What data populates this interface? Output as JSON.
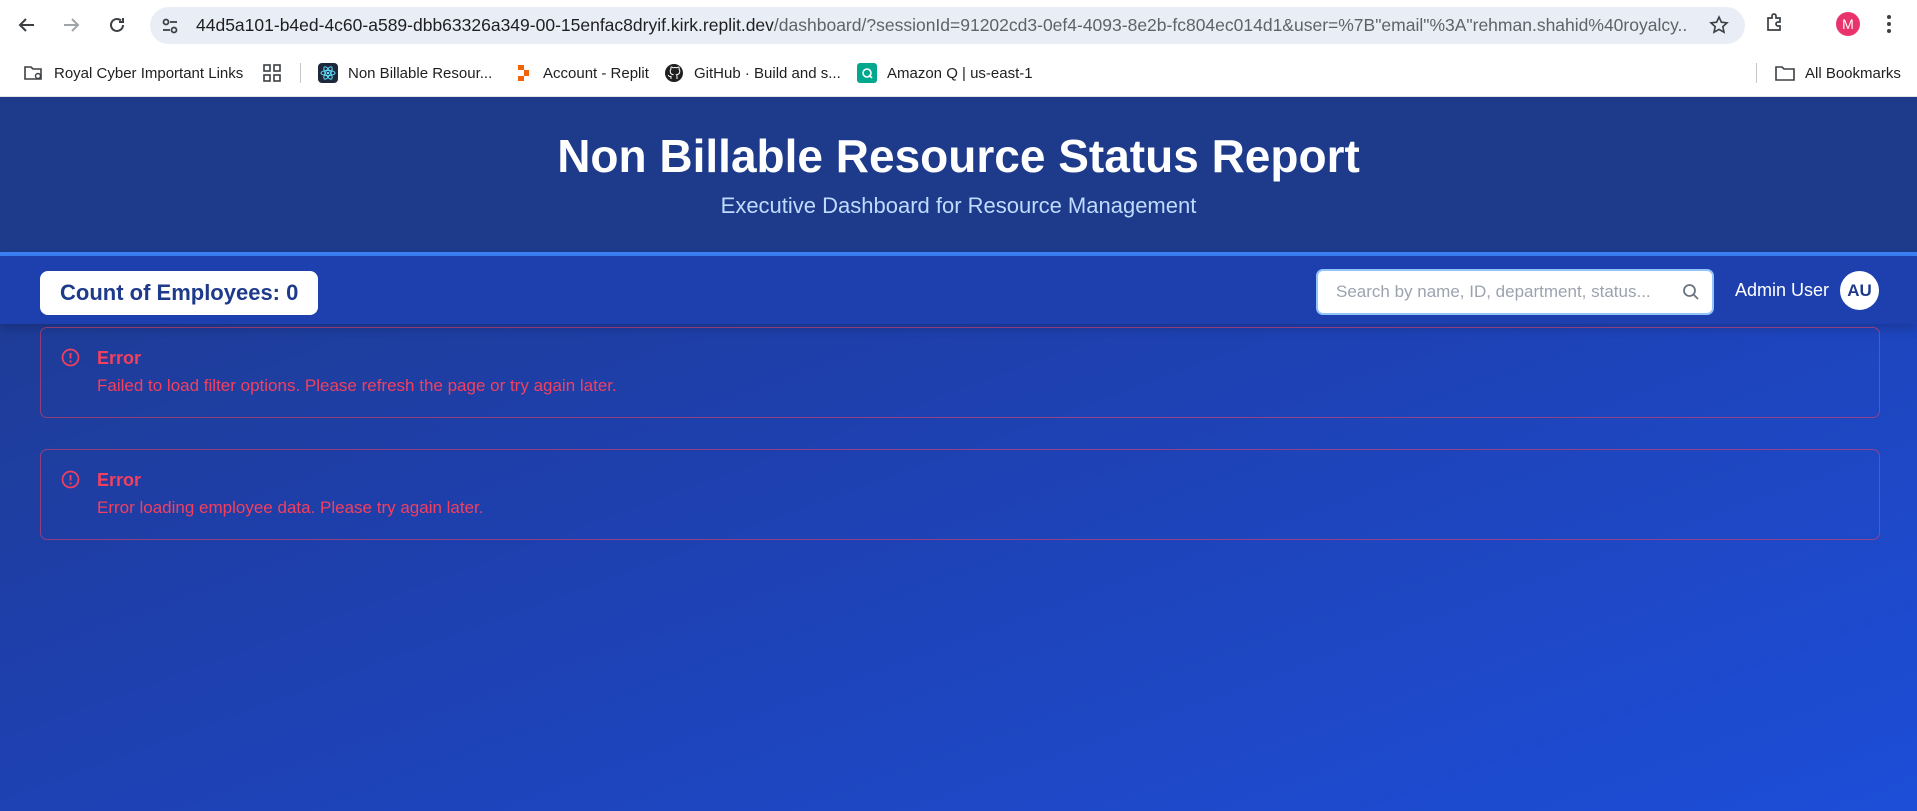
{
  "browser": {
    "url_host": "44d5a101-b4ed-4c60-a589-dbb63326a349-00-15enfac8dryif.kirk.replit.dev",
    "url_path": "/dashboard/?sessionId=91202cd3-0ef4-4093-8e2b-fc804ec014d1&user=%7B\"email\"%3A\"rehman.shahid%40royalcy...",
    "profile_initial": "M",
    "bookmarks": [
      {
        "label": "Royal Cyber Important Links",
        "icon": "folder-gear-icon"
      },
      {
        "label": "Non Billable Resour...",
        "icon": "react-icon"
      },
      {
        "label": "Account - Replit",
        "icon": "replit-icon"
      },
      {
        "label": "GitHub · Build and s...",
        "icon": "github-icon"
      },
      {
        "label": "Amazon Q | us-east-1",
        "icon": "amazon-q-icon"
      }
    ],
    "all_bookmarks_label": "All Bookmarks"
  },
  "header": {
    "title": "Non Billable Resource Status Report",
    "subtitle": "Executive Dashboard for Resource Management"
  },
  "toolbar": {
    "count_label": "Count of Employees: 0",
    "search_placeholder": "Search by name, ID, department, status...",
    "user_name": "Admin User",
    "user_initials": "AU"
  },
  "errors": [
    {
      "title": "Error",
      "message": "Failed to load filter options. Please refresh the page or try again later."
    },
    {
      "title": "Error",
      "message": "Error loading employee data. Please try again later."
    }
  ],
  "colors": {
    "header_bg": "#1e3a8a",
    "page_bg": "#1e40af",
    "accent": "#3b82f6",
    "error": "#f43f5e"
  }
}
